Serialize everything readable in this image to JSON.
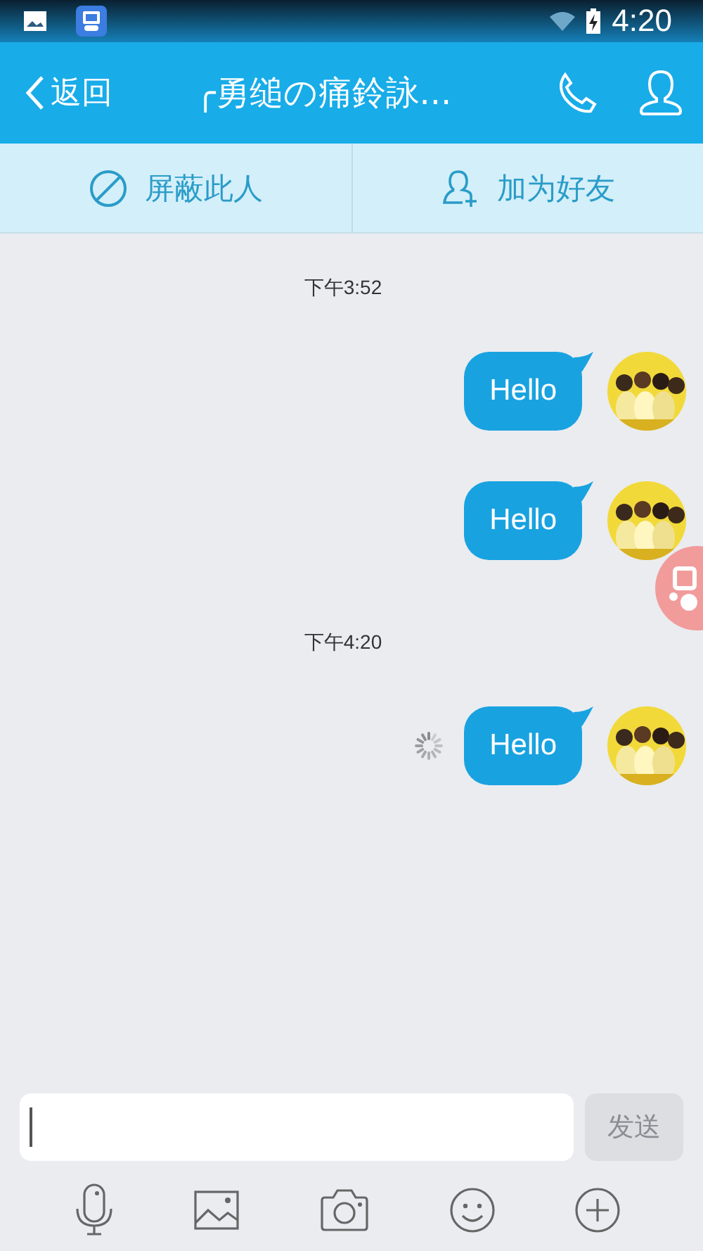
{
  "status_bar": {
    "time": "4:20"
  },
  "header": {
    "back": "返回",
    "title": "╭勇缒の痛鈴詠..."
  },
  "actions": [
    {
      "label": "屏蔽此人",
      "kind": "block"
    },
    {
      "label": "加为好友",
      "kind": "add"
    }
  ],
  "messages": [
    {
      "kind": "time",
      "text": "下午3:52"
    },
    {
      "kind": "message",
      "text": "Hello",
      "sending": false
    },
    {
      "kind": "message",
      "text": "Hello",
      "sending": false
    },
    {
      "kind": "time",
      "text": "下午4:20"
    },
    {
      "kind": "message",
      "text": "Hello",
      "sending": true
    }
  ],
  "composer": {
    "send": "发送",
    "send_disabled": true
  }
}
